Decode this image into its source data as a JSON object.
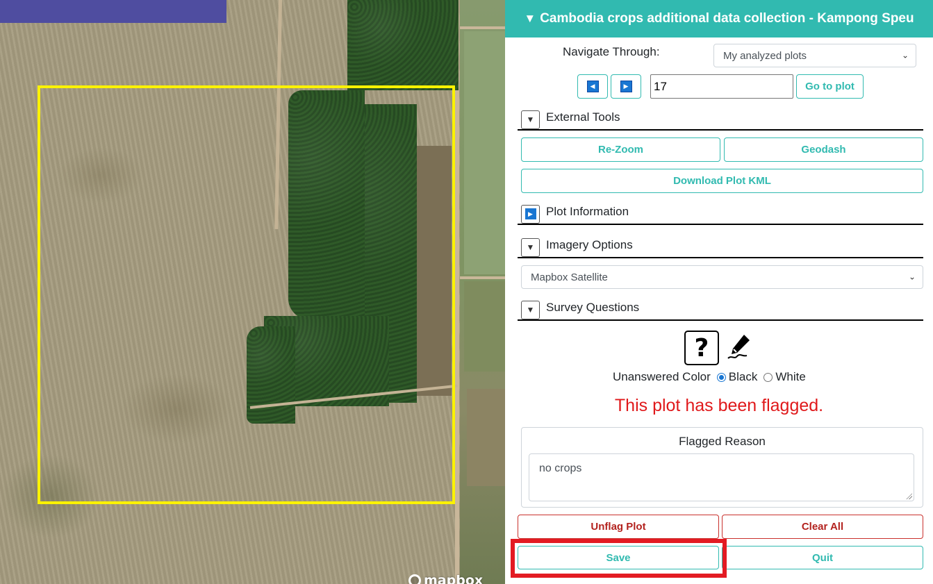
{
  "sidebar": {
    "header_title": "Cambodia crops additional data collection - Kampong Speu",
    "header_caret": "▼",
    "navigate_label": "Navigate Through:",
    "navigate_selected": "My analyzed plots",
    "plot_number": "17",
    "goto_label": "Go to plot",
    "sections": {
      "external_tools": "External Tools",
      "plot_information": "Plot Information",
      "imagery_options": "Imagery Options",
      "survey_questions": "Survey Questions"
    },
    "rezoom_label": "Re-Zoom",
    "geodash_label": "Geodash",
    "kml_label": "Download Plot KML",
    "imagery_selected": "Mapbox Satellite",
    "help_glyph": "?",
    "unanswered_label": "Unanswered Color",
    "color_black": "Black",
    "color_white": "White",
    "flag_message": "This plot has been flagged.",
    "flag_reason_label": "Flagged Reason",
    "flag_reason_value": "no crops",
    "unflag_label": "Unflag Plot",
    "clear_label": "Clear All",
    "save_label": "Save",
    "quit_label": "Quit"
  },
  "map": {
    "logo_text": "mapbox",
    "boundary_color": "#fbf200"
  },
  "colors": {
    "accent": "#31bab0",
    "danger": "#e0191b",
    "highlight": "#e31b23"
  }
}
